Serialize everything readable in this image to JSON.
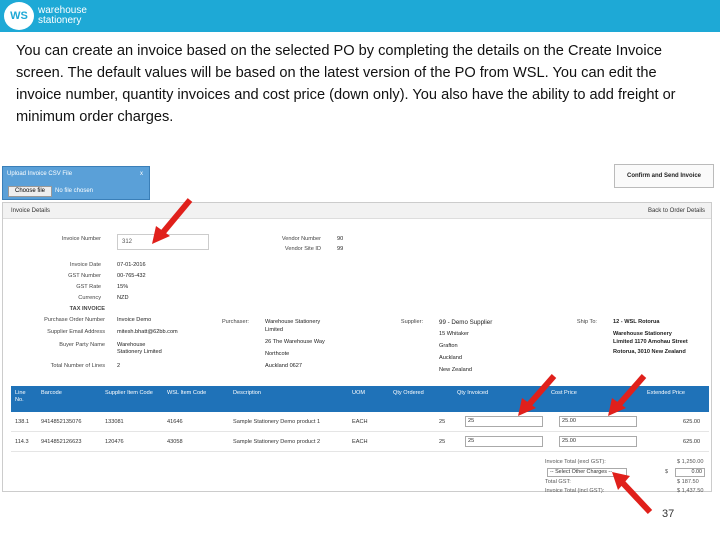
{
  "brand": {
    "logo": "WS",
    "name_line1": "warehouse",
    "name_line2": "stationery"
  },
  "caption": "You can create an invoice based on the selected PO by completing the details on the Create Invoice screen.  The default values will be based on the latest version of the PO from WSL. You can edit the invoice number, quantity invoices and cost price (down only).  You also have the ability to add freight or minimum order charges.",
  "upload": {
    "title": "Upload Invoice CSV File",
    "close": "x",
    "choose_label": "Choose file",
    "no_file": "No file chosen"
  },
  "confirm_label": "Confirm and Send Invoice",
  "panel": {
    "title": "Invoice Details",
    "back_label": "Back to Order Details"
  },
  "invoice": {
    "number_label": "Invoice Number",
    "number_value": "312",
    "date_label": "Invoice Date",
    "date_value": "07-01-2016",
    "gst_label": "GST Number",
    "gst_value": "00-765-432",
    "gst_rate_label": "GST Rate",
    "gst_rate_value": "15%",
    "currency_label": "Currency",
    "currency_value": "NZD",
    "tax_invoice": "TAX INVOICE",
    "po_label": "Purchase Order Number",
    "po_value": "Invoice Demo",
    "email_label": "Supplier Email Address",
    "email_value": "mitesh.bhatt@62bb.com",
    "buyer_label": "Buyer Party Name",
    "buyer_value1": "Warehouse",
    "buyer_value2": "Stationery Limited",
    "lines_label": "Total Number of Lines",
    "lines_value": "2"
  },
  "vendor": {
    "number_label": "Vendor Number",
    "number_value": "90",
    "site_label": "Vendor Site ID",
    "site_value": "99"
  },
  "purchaser": {
    "label": "Purchaser:",
    "l1": "Warehouse Stationery",
    "l2": "Limited",
    "l3": "26 The Warehouse Way",
    "l4": "Northcote",
    "l5": "Auckland 0627"
  },
  "supplier": {
    "label": "Supplier:",
    "l1": "99 - Demo Supplier",
    "l2": "15 Whitaker",
    "l3": "Grafton",
    "l4": "Auckland",
    "l5": "New Zealand"
  },
  "shipto": {
    "label": "Ship To:",
    "l1": "12 - WSL Rotorua",
    "l2": "Warehouse Stationery",
    "l3": "Limited 1170 Amohau Street",
    "l4": "Rotorua, 3010 New Zealand"
  },
  "table": {
    "headers": [
      "Line No.",
      "Barcode",
      "Supplier Item Code",
      "WSL Item Code",
      "Description",
      "UOM",
      "Qty Ordered",
      "Qty Invoiced",
      "Cost Price",
      "Extended Price"
    ],
    "rows": [
      [
        "138.1",
        "9414852135076",
        "133081",
        "41646",
        "Sample Stationery Demo product 1",
        "EACH",
        "25",
        "25",
        "25.00",
        "625.00"
      ],
      [
        "114.3",
        "9414852126623",
        "120476",
        "43058",
        "Sample Stationery Demo product 2",
        "EACH",
        "25",
        "25",
        "25.00",
        "625.00"
      ]
    ]
  },
  "totals": {
    "excl_label": "Invoice Total (excl GST):",
    "excl_value": "$ 1,250.00",
    "charges_placeholder": "-- Select Other Charges --",
    "charges_currency": "$",
    "charges_value": "0.00",
    "gst_label": "Total GST:",
    "gst_value": "$ 187.50",
    "incl_label": "Invoice Total (incl GST):",
    "incl_value": "$ 1,437.50"
  },
  "page_number": "37",
  "colors": {
    "brand": "#1ea9d6",
    "table_header": "#1f72b8",
    "arrow": "#e0201b"
  }
}
